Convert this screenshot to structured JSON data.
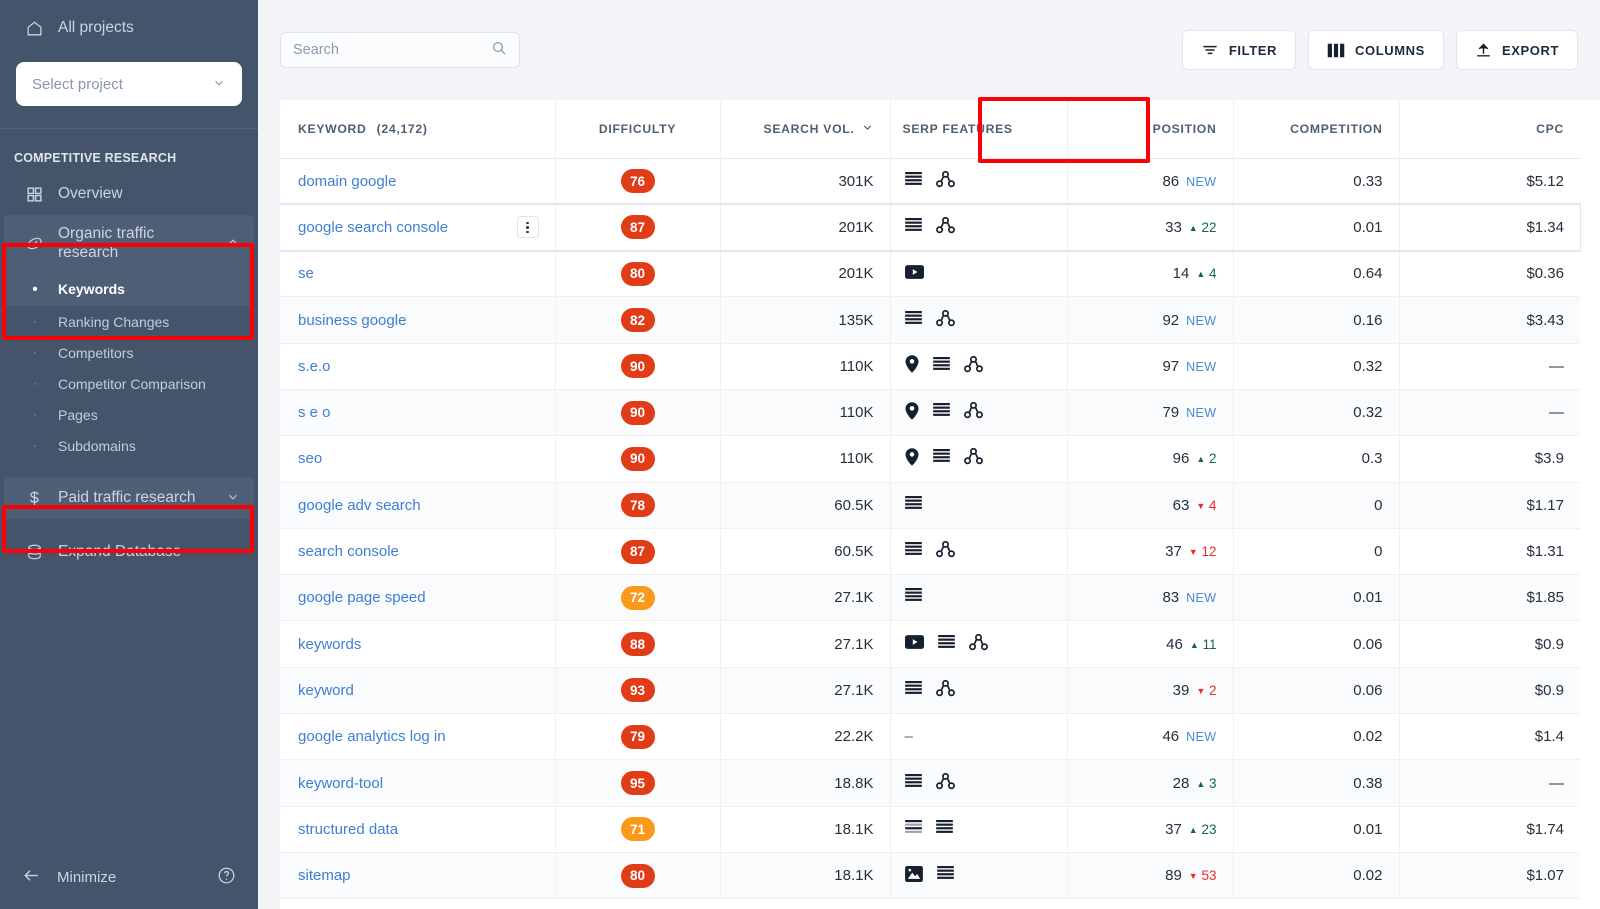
{
  "sidebar": {
    "all_projects": "All projects",
    "project_select_placeholder": "Select project",
    "section_title": "COMPETITIVE RESEARCH",
    "overview": "Overview",
    "organic_group": "Organic traffic research",
    "organic_children": [
      {
        "label": "Keywords",
        "selected": true
      },
      {
        "label": "Ranking Changes",
        "selected": false
      },
      {
        "label": "Competitors",
        "selected": false
      },
      {
        "label": "Competitor Comparison",
        "selected": false
      },
      {
        "label": "Pages",
        "selected": false
      },
      {
        "label": "Subdomains",
        "selected": false
      }
    ],
    "paid_group": "Paid traffic research",
    "expand_database": "Expand Database",
    "minimize": "Minimize",
    "colors": {
      "bg": "#44546b",
      "active": "#4e5e75",
      "text": "#ccd4df"
    }
  },
  "toolbar": {
    "search_placeholder": "Search",
    "search_value": "",
    "filter_label": "FILTER",
    "columns_label": "COLUMNS",
    "export_label": "EXPORT"
  },
  "highlight_color": "#fb0007",
  "table": {
    "columns": [
      {
        "key": "keyword",
        "label": "KEYWORD",
        "count": "(24,172)"
      },
      {
        "key": "difficulty",
        "label": "DIFFICULTY"
      },
      {
        "key": "search_vol",
        "label": "SEARCH VOL.",
        "sorted": true,
        "sort_dir": "desc"
      },
      {
        "key": "serp",
        "label": "SERP FEATURES"
      },
      {
        "key": "position",
        "label": "POSITION"
      },
      {
        "key": "competition",
        "label": "COMPETITION"
      },
      {
        "key": "cpc",
        "label": "CPC"
      }
    ],
    "rows": [
      {
        "keyword": "domain google",
        "difficulty": "76",
        "diff_color": "red",
        "volume": "301K",
        "serp": [
          "snippet",
          "related"
        ],
        "position": "86",
        "delta": "NEW",
        "delta_dir": "new",
        "competition": "0.33",
        "cpc": "$5.12",
        "menu": false
      },
      {
        "keyword": "google search console",
        "difficulty": "87",
        "diff_color": "red",
        "volume": "201K",
        "serp": [
          "snippet",
          "related"
        ],
        "position": "33",
        "delta": "22",
        "delta_dir": "up",
        "competition": "0.01",
        "cpc": "$1.34",
        "menu": true
      },
      {
        "keyword": "se",
        "difficulty": "80",
        "diff_color": "red",
        "volume": "201K",
        "serp": [
          "video"
        ],
        "position": "14",
        "delta": "4",
        "delta_dir": "up",
        "competition": "0.64",
        "cpc": "$0.36",
        "menu": false
      },
      {
        "keyword": "business google",
        "difficulty": "82",
        "diff_color": "red",
        "volume": "135K",
        "serp": [
          "snippet",
          "related"
        ],
        "position": "92",
        "delta": "NEW",
        "delta_dir": "new",
        "competition": "0.16",
        "cpc": "$3.43",
        "menu": false
      },
      {
        "keyword": "s.e.o",
        "difficulty": "90",
        "diff_color": "red",
        "volume": "110K",
        "serp": [
          "local",
          "snippet",
          "related"
        ],
        "position": "97",
        "delta": "NEW",
        "delta_dir": "new",
        "competition": "0.32",
        "cpc": "—",
        "menu": false
      },
      {
        "keyword": "s e o",
        "difficulty": "90",
        "diff_color": "red",
        "volume": "110K",
        "serp": [
          "local",
          "snippet",
          "related"
        ],
        "position": "79",
        "delta": "NEW",
        "delta_dir": "new",
        "competition": "0.32",
        "cpc": "—",
        "menu": false
      },
      {
        "keyword": "seo",
        "difficulty": "90",
        "diff_color": "red",
        "volume": "110K",
        "serp": [
          "local",
          "snippet",
          "related"
        ],
        "position": "96",
        "delta": "2",
        "delta_dir": "up",
        "competition": "0.3",
        "cpc": "$3.9",
        "menu": false
      },
      {
        "keyword": "google adv search",
        "difficulty": "78",
        "diff_color": "red",
        "volume": "60.5K",
        "serp": [
          "snippet"
        ],
        "position": "63",
        "delta": "4",
        "delta_dir": "down",
        "competition": "0",
        "cpc": "$1.17",
        "menu": false
      },
      {
        "keyword": "search console",
        "difficulty": "87",
        "diff_color": "red",
        "volume": "60.5K",
        "serp": [
          "snippet",
          "related"
        ],
        "position": "37",
        "delta": "12",
        "delta_dir": "down",
        "competition": "0",
        "cpc": "$1.31",
        "menu": false
      },
      {
        "keyword": "google page speed",
        "difficulty": "72",
        "diff_color": "orange",
        "volume": "27.1K",
        "serp": [
          "snippet"
        ],
        "position": "83",
        "delta": "NEW",
        "delta_dir": "new",
        "competition": "0.01",
        "cpc": "$1.85",
        "menu": false
      },
      {
        "keyword": "keywords",
        "difficulty": "88",
        "diff_color": "red",
        "volume": "27.1K",
        "serp": [
          "video",
          "snippet",
          "related"
        ],
        "position": "46",
        "delta": "11",
        "delta_dir": "up",
        "competition": "0.06",
        "cpc": "$0.9",
        "menu": false
      },
      {
        "keyword": "keyword",
        "difficulty": "93",
        "diff_color": "red",
        "volume": "27.1K",
        "serp": [
          "snippet",
          "related"
        ],
        "position": "39",
        "delta": "2",
        "delta_dir": "down",
        "competition": "0.06",
        "cpc": "$0.9",
        "menu": false
      },
      {
        "keyword": "google analytics log in",
        "difficulty": "79",
        "diff_color": "red",
        "volume": "22.2K",
        "serp": [
          "none"
        ],
        "position": "46",
        "delta": "NEW",
        "delta_dir": "new",
        "competition": "0.02",
        "cpc": "$1.4",
        "menu": false
      },
      {
        "keyword": "keyword-tool",
        "difficulty": "95",
        "diff_color": "red",
        "volume": "18.8K",
        "serp": [
          "snippet",
          "related"
        ],
        "position": "28",
        "delta": "3",
        "delta_dir": "up",
        "competition": "0.38",
        "cpc": "—",
        "menu": false
      },
      {
        "keyword": "structured data",
        "difficulty": "71",
        "diff_color": "orange",
        "volume": "18.1K",
        "serp": [
          "reviews",
          "snippet"
        ],
        "position": "37",
        "delta": "23",
        "delta_dir": "up",
        "competition": "0.01",
        "cpc": "$1.74",
        "menu": false
      },
      {
        "keyword": "sitemap",
        "difficulty": "80",
        "diff_color": "red",
        "volume": "18.1K",
        "serp": [
          "image",
          "snippet"
        ],
        "position": "89",
        "delta": "53",
        "delta_dir": "down",
        "competition": "0.02",
        "cpc": "$1.07",
        "menu": false
      }
    ]
  }
}
